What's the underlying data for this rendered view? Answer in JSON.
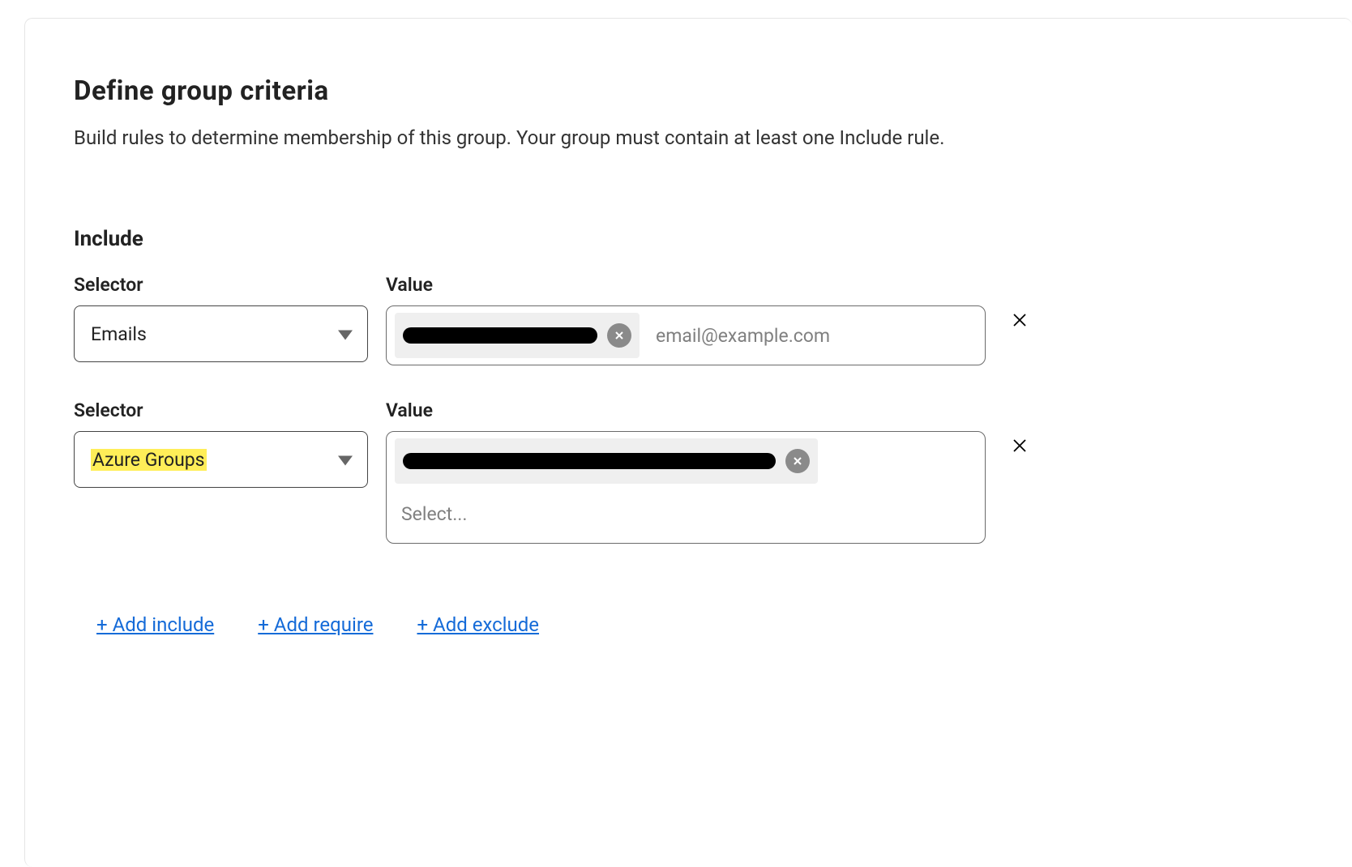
{
  "title": "Define group criteria",
  "description": "Build rules to determine membership of this group. Your group must contain at least one Include rule.",
  "section_include": "Include",
  "labels": {
    "selector": "Selector",
    "value": "Value"
  },
  "rows": [
    {
      "selector": "Emails",
      "selector_highlight": false,
      "value_placeholder": "email@example.com",
      "value_chip_redacted": true
    },
    {
      "selector": "Azure Groups",
      "selector_highlight": true,
      "value_placeholder": "Select...",
      "value_chip_redacted": true
    }
  ],
  "actions": {
    "add_include": "+ Add include",
    "add_require": "+ Add require",
    "add_exclude": "+ Add exclude"
  }
}
